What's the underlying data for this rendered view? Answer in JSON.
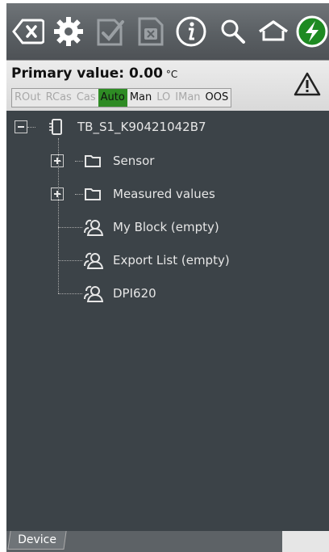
{
  "toolbar": {
    "icons": [
      "backspace-icon",
      "gear-icon",
      "apply-icon",
      "cancel-icon",
      "info-icon",
      "search-icon",
      "home-icon",
      "connect-icon"
    ]
  },
  "status": {
    "primary_label": "Primary value: 0.00",
    "unit": "°C",
    "modes": [
      "ROut",
      "RCas",
      "Cas",
      "Auto",
      "Man",
      "LO",
      "IMan",
      "OOS"
    ],
    "active_mode": "Auto",
    "colors": {
      "active": "#2e8b24"
    }
  },
  "tree": {
    "root": "TB_S1_K90421042B7",
    "items": [
      {
        "label": "Sensor",
        "type": "folder"
      },
      {
        "label": "Measured values",
        "type": "folder"
      },
      {
        "label": "My Block (empty)",
        "type": "user-block"
      },
      {
        "label": "Export List (empty)",
        "type": "user-block"
      },
      {
        "label": "DPI620",
        "type": "user-block"
      }
    ]
  },
  "footer": {
    "tab": "Device"
  }
}
